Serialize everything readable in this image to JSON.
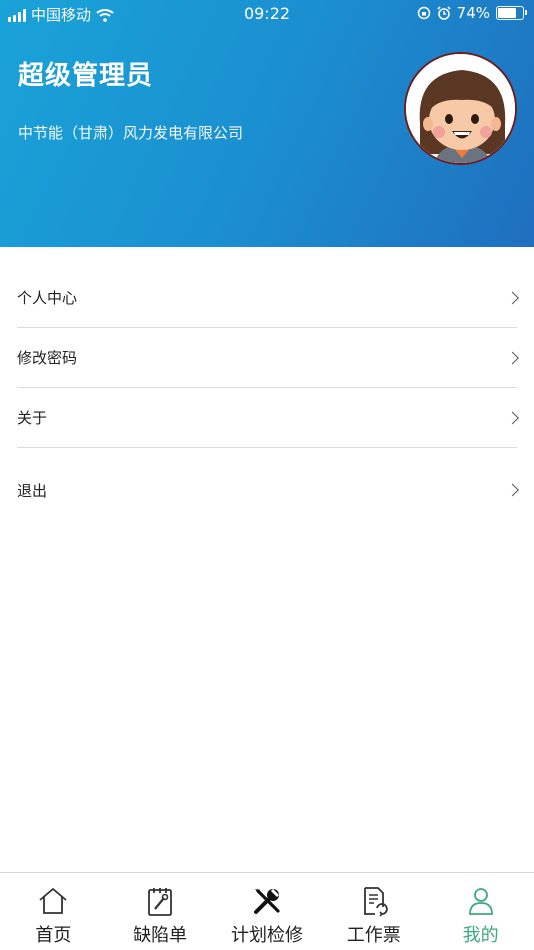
{
  "status_bar": {
    "carrier": "中国移动",
    "time": "09:22",
    "battery": "74%",
    "battery_level": 0.74
  },
  "profile": {
    "name": "超级管理员",
    "company": "中节能（甘肃）风力发电有限公司",
    "avatar_icon": "cartoon-girl-avatar"
  },
  "menu": [
    {
      "label": "个人中心"
    },
    {
      "label": "修改密码"
    },
    {
      "label": "关于"
    },
    {
      "label": "退出"
    }
  ],
  "tabs": [
    {
      "label": "首页",
      "icon": "home-icon"
    },
    {
      "label": "缺陷单",
      "icon": "defect-clipboard-icon"
    },
    {
      "label": "计划检修",
      "icon": "tools-icon"
    },
    {
      "label": "工作票",
      "icon": "work-ticket-icon"
    },
    {
      "label": "我的",
      "icon": "user-icon",
      "active": true
    }
  ],
  "colors": {
    "header_start": "#1aa3d8",
    "header_end": "#1f6fbf",
    "active_tab": "#3faa7d"
  }
}
